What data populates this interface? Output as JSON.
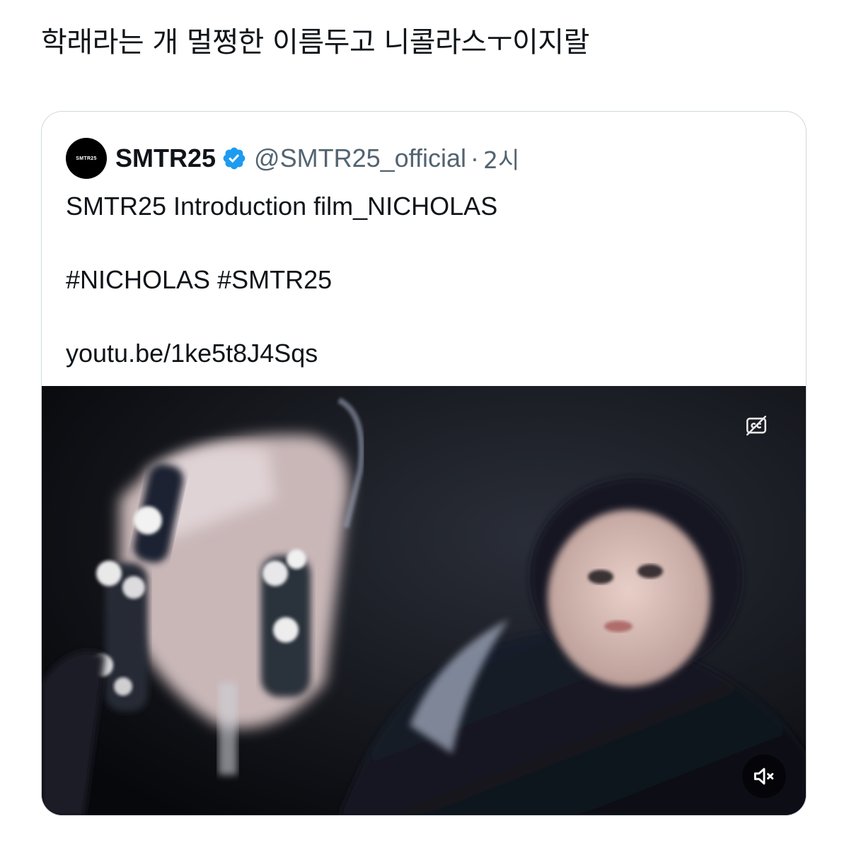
{
  "post": {
    "text": "학래라는 개 멀쩡한 이름두고 니콜라스ㅜ이지랄"
  },
  "quote": {
    "avatar_text": "SMTR25",
    "display_name": "SMTR25",
    "verified": true,
    "handle": "@SMTR25_official",
    "separator": "·",
    "time": "2시",
    "body": {
      "title_line": "SMTR25 Introduction film_NICHOLAS",
      "hashtags_line": "#NICHOLAS #SMTR25",
      "link_line": "youtu.be/1ke5t8J4Sqs"
    },
    "media": {
      "type": "video",
      "captions_icon": "closed-captions-off-icon",
      "mute_icon": "muted-speaker-icon"
    }
  },
  "colors": {
    "text_primary": "#0f1419",
    "text_secondary": "#536471",
    "verified_blue": "#1d9bf0",
    "card_border": "#cfd9de"
  }
}
